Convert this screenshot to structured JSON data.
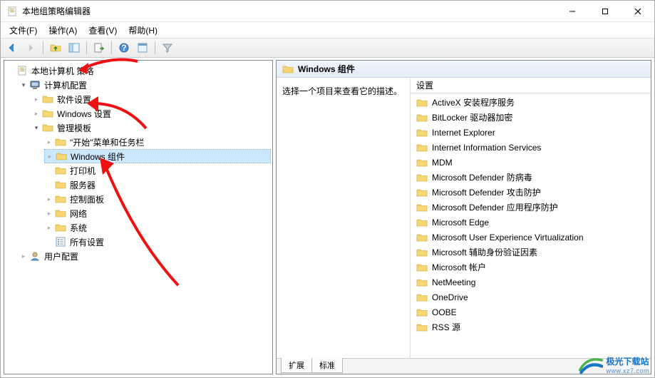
{
  "window_title": "本地组策略编辑器",
  "menus": {
    "file": "文件(F)",
    "action": "操作(A)",
    "view": "查看(V)",
    "help": "帮助(H)"
  },
  "tree": {
    "root": "本地计算机 策略",
    "computer_config": "计算机配置",
    "software_settings": "软件设置",
    "windows_settings": "Windows 设置",
    "admin_templates": "管理模板",
    "start_taskbar": "\"开始\"菜单和任务栏",
    "windows_components": "Windows 组件",
    "printers": "打印机",
    "servers": "服务器",
    "control_panel": "控制面板",
    "network": "网络",
    "system": "系统",
    "all_settings": "所有设置",
    "user_config": "用户配置"
  },
  "right": {
    "header": "Windows 组件",
    "description": "选择一个项目来查看它的描述。",
    "column_header": "设置",
    "items": [
      "ActiveX 安装程序服务",
      "BitLocker 驱动器加密",
      "Internet Explorer",
      "Internet Information Services",
      "MDM",
      "Microsoft Defender 防病毒",
      "Microsoft Defender 攻击防护",
      "Microsoft Defender 应用程序防护",
      "Microsoft Edge",
      "Microsoft User Experience Virtualization",
      "Microsoft 辅助身份验证因素",
      "Microsoft 帐户",
      "NetMeeting",
      "OneDrive",
      "OOBE",
      "RSS 源"
    ],
    "tabs": {
      "extended": "扩展",
      "standard": "标准"
    }
  },
  "watermark": {
    "name": "极光下载站",
    "url": "www.xz7.com"
  }
}
